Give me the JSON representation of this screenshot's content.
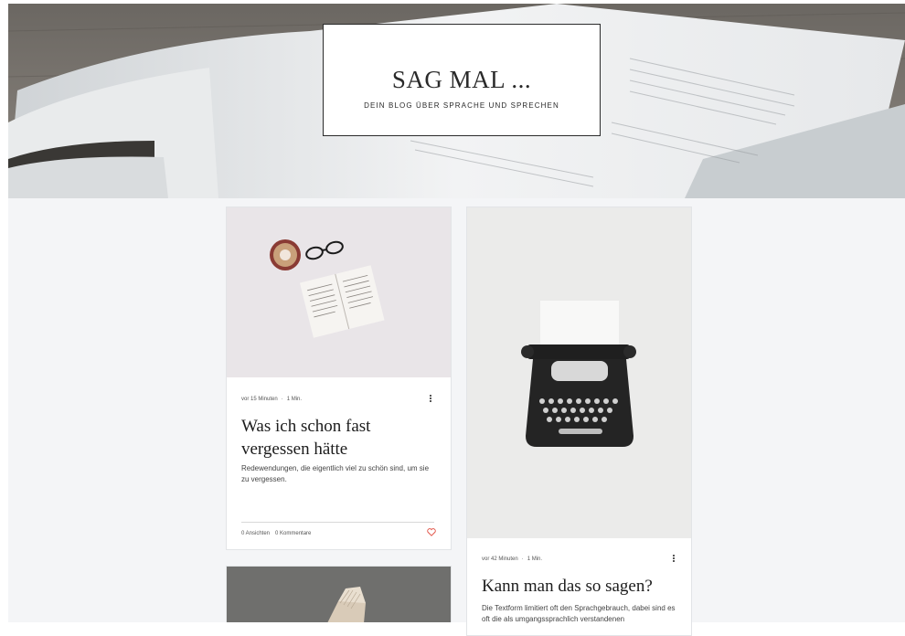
{
  "header": {
    "title": "SAG MAL ...",
    "tagline": "DEIN BLOG ÜBER SPRACHE UND SPRECHEN"
  },
  "posts": [
    {
      "time_ago": "vor 15 Minuten",
      "separator": "·",
      "read_time": "1 Min.",
      "title": "Was ich schon fast vergessen hätte",
      "excerpt": "Redewendungen, die eigentlich viel zu schön sind, um sie zu vergessen.",
      "views": "0 Ansichten",
      "comments": "0 Kommentare",
      "image": "coffee-glasses-book-photo"
    },
    {
      "time_ago": "vor 42 Minuten",
      "separator": "·",
      "read_time": "1 Min.",
      "title": "Kann man das so sagen?",
      "excerpt": "Die Textform limitiert oft den Sprachgebrauch, dabei sind es oft die als umgangssprachlich verstandenen",
      "image": "typewriter-photo"
    },
    {
      "image": "open-book-photo"
    }
  ],
  "colors": {
    "heart": "#e2564a",
    "background": "#f4f5f7"
  },
  "icons": {
    "more": "more-vertical-icon",
    "like": "heart-icon"
  }
}
